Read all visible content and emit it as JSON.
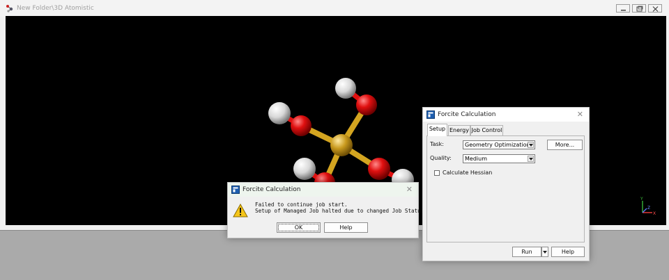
{
  "main_window": {
    "title": "New Folder\\3D Atomistic",
    "icon": "molecule-document-icon",
    "controls": [
      "minimize-icon",
      "restore-icon",
      "close-icon"
    ]
  },
  "axes": {
    "y_label": "Y",
    "z_label": "Z",
    "x_label": "X"
  },
  "alert_dialog": {
    "title": "Forcite Calculation",
    "icon": "warning-icon",
    "message_line1": "Failed to continue job start.",
    "message_line2": "Setup of Managed Job halted due to changed Job Status.",
    "ok_label": "OK",
    "help_label": "Help"
  },
  "forcite_dialog": {
    "title": "Forcite Calculation",
    "close_label": "✕",
    "tabs": [
      {
        "label": "Setup",
        "active": true
      },
      {
        "label": "Energy",
        "active": false
      },
      {
        "label": "Job Control",
        "active": false
      }
    ],
    "task_label": "Task:",
    "task_value": "Geometry Optimization",
    "more_label": "More...",
    "quality_label": "Quality:",
    "quality_value": "Medium",
    "hessian_label": "Calculate Hessian",
    "hessian_checked": false,
    "run_label": "Run",
    "help_label": "Help"
  },
  "colors": {
    "viewport_bg": "#000000",
    "oxygen": "#e01010",
    "hydrogen": "#e8e8e8",
    "central_atom": "#d4a520"
  }
}
